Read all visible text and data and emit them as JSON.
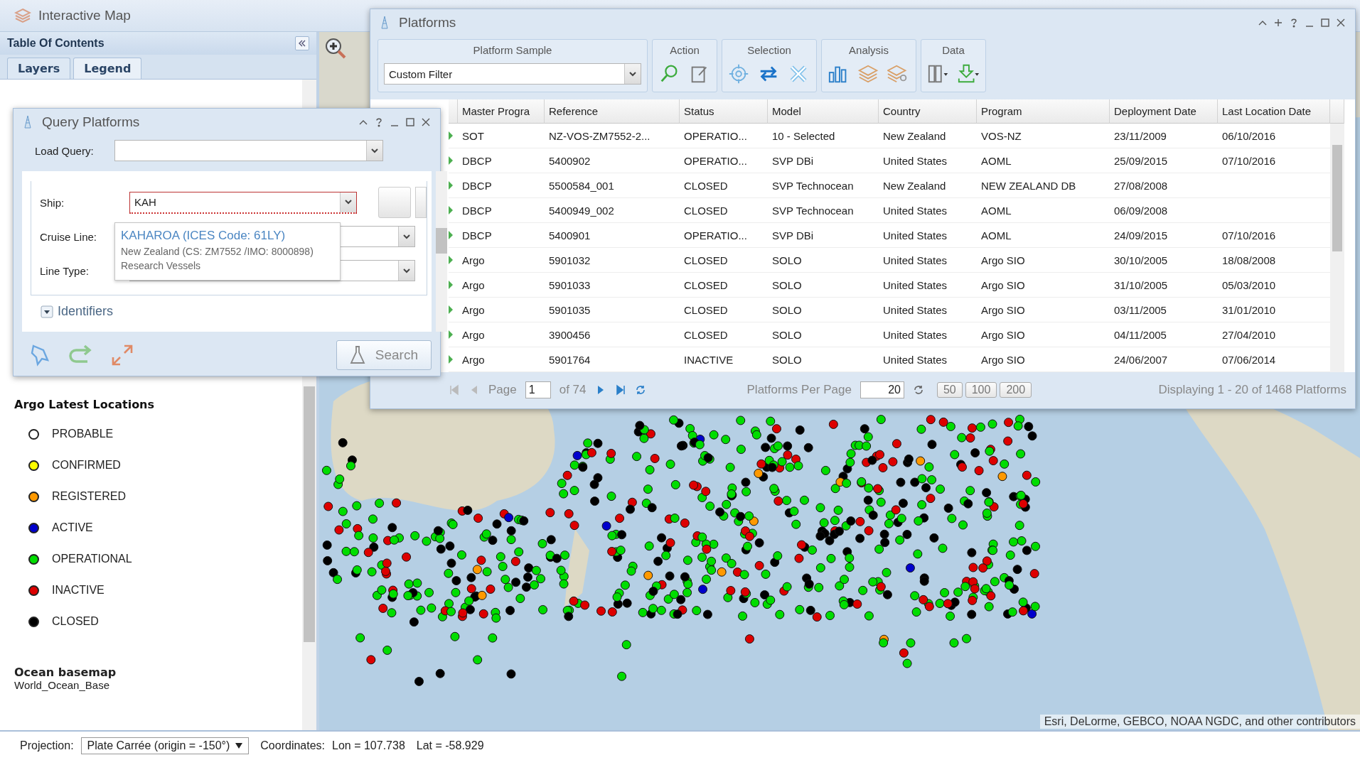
{
  "app_title": "Interactive Map",
  "toc": {
    "title": "Table Of Contents",
    "tabs": [
      {
        "label": "Layers",
        "selected": false
      },
      {
        "label": "Legend",
        "selected": true
      }
    ],
    "legend_title": "Argo Latest Locations",
    "legend": [
      {
        "label": "PROBABLE",
        "color": "#ffffff"
      },
      {
        "label": "CONFIRMED",
        "color": "#ffff00"
      },
      {
        "label": "REGISTERED",
        "color": "#ff9900"
      },
      {
        "label": "ACTIVE",
        "color": "#0000cc"
      },
      {
        "label": "OPERATIONAL",
        "color": "#00dd00"
      },
      {
        "label": "INACTIVE",
        "color": "#dd0000"
      },
      {
        "label": "CLOSED",
        "color": "#000000"
      }
    ],
    "basemap_title": "Ocean basemap",
    "basemap_name": "World_Ocean_Base"
  },
  "map": {
    "attribution": "Esri, DeLorme, GEBCO, NOAA NGDC, and other contributors"
  },
  "platforms": {
    "title": "Platforms",
    "toolbar": [
      {
        "label": "Platform Sample",
        "kind": "dropdown",
        "value": "Custom Filter"
      },
      {
        "label": "Action",
        "kind": "icons"
      },
      {
        "label": "Selection",
        "kind": "icons"
      },
      {
        "label": "Analysis",
        "kind": "icons"
      },
      {
        "label": "Data",
        "kind": "icons"
      }
    ],
    "columns": [
      "Master Progra",
      "Reference",
      "Status",
      "Model",
      "Country",
      "Program",
      "Deployment Date",
      "Last Location Date"
    ],
    "rows": [
      [
        "SOT",
        "NZ-VOS-ZM7552-2...",
        "OPERATIO...",
        "10 - Selected",
        "New Zealand",
        "VOS-NZ",
        "23/11/2009",
        "06/10/2016"
      ],
      [
        "DBCP",
        "5400902",
        "OPERATIO...",
        "SVP DBi",
        "United States",
        "AOML",
        "25/09/2015",
        "07/10/2016"
      ],
      [
        "DBCP",
        "5500584_001",
        "CLOSED",
        "SVP Technocean",
        "New Zealand",
        "NEW ZEALAND DB",
        "27/08/2008",
        ""
      ],
      [
        "DBCP",
        "5400949_002",
        "CLOSED",
        "SVP Technocean",
        "United States",
        "AOML",
        "06/09/2008",
        ""
      ],
      [
        "DBCP",
        "5400901",
        "OPERATIO...",
        "SVP DBi",
        "United States",
        "AOML",
        "24/09/2015",
        "07/10/2016"
      ],
      [
        "Argo",
        "5901032",
        "CLOSED",
        "SOLO",
        "United States",
        "Argo SIO",
        "30/10/2005",
        "18/08/2008"
      ],
      [
        "Argo",
        "5901033",
        "CLOSED",
        "SOLO",
        "United States",
        "Argo SIO",
        "31/10/2005",
        "05/03/2010"
      ],
      [
        "Argo",
        "5901035",
        "CLOSED",
        "SOLO",
        "United States",
        "Argo SIO",
        "03/11/2005",
        "31/01/2010"
      ],
      [
        "Argo",
        "3900456",
        "CLOSED",
        "SOLO",
        "United States",
        "Argo SIO",
        "04/11/2005",
        "27/04/2010"
      ],
      [
        "Argo",
        "5901764",
        "INACTIVE",
        "SOLO",
        "United States",
        "Argo SIO",
        "24/06/2007",
        "07/06/2014"
      ]
    ],
    "pager": {
      "back_disabled": true,
      "page_label": "Page",
      "page": "1",
      "of": "of 74",
      "per_page_label": "Platforms Per Page",
      "per_page": "20",
      "sizes": [
        "50",
        "100",
        "200"
      ],
      "display": "Displaying 1 - 20 of 1468 Platforms"
    }
  },
  "query": {
    "title": "Query Platforms",
    "load_query_label": "Load Query:",
    "fields": [
      {
        "label": "Ship:",
        "value": "KAH",
        "invalid": true
      },
      {
        "label": "Cruise Line:",
        "invalid": false
      },
      {
        "label": "Line Type:",
        "invalid": false
      }
    ],
    "suggestion": {
      "name": "KAHAROA (ICES Code: 61LY)",
      "detail": "New Zealand (CS: ZM7552 /IMO: 8000898)",
      "category": "Research Vessels"
    },
    "section": "Identifiers",
    "search_button": "Search"
  },
  "status_bar": {
    "projection_label": "Projection:",
    "projection": "Plate Carrée (origin = -150°)",
    "coordinates_label": "Coordinates:",
    "lon": "Lon = 107.738",
    "lat": "Lat = -58.929"
  }
}
